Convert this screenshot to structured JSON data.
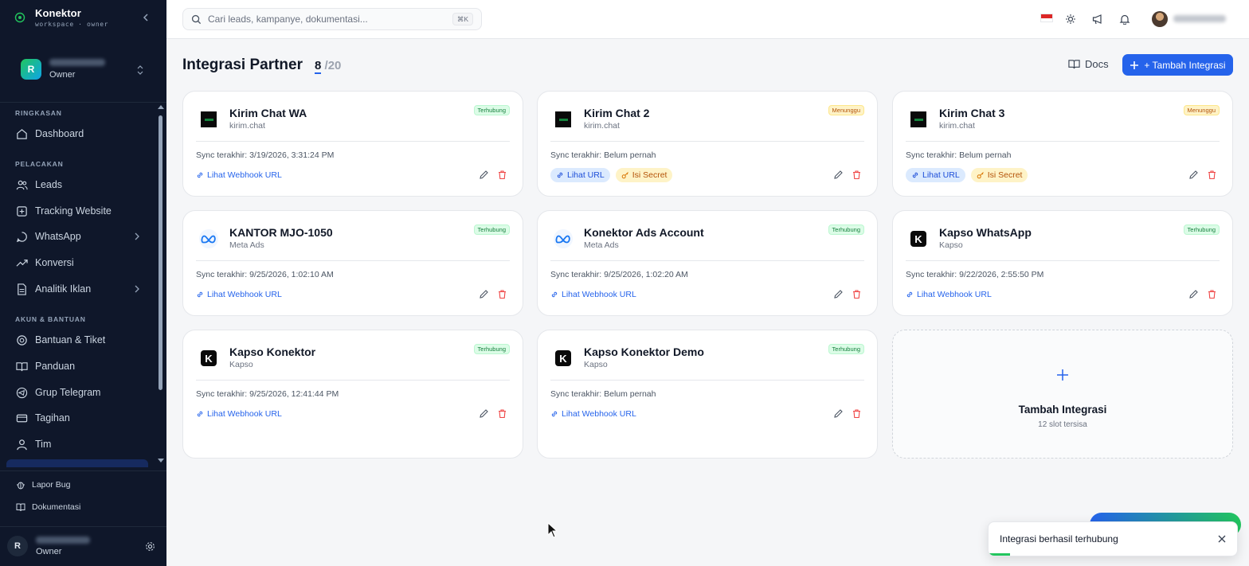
{
  "brand": {
    "name": "Konektor",
    "subtitle": "workspace · owner"
  },
  "workspace": {
    "initial": "R",
    "role": "Owner"
  },
  "nav": {
    "sections": [
      {
        "label": "RINGKASAN",
        "items": [
          {
            "label": "Dashboard",
            "icon": "home-icon"
          }
        ]
      },
      {
        "label": "PELACAKAN",
        "items": [
          {
            "label": "Leads",
            "icon": "users-icon"
          },
          {
            "label": "Tracking Website",
            "icon": "tracking-icon"
          },
          {
            "label": "WhatsApp",
            "icon": "whatsapp-icon",
            "expandable": true
          },
          {
            "label": "Konversi",
            "icon": "trend-icon"
          },
          {
            "label": "Analitik Iklan",
            "icon": "document-icon",
            "expandable": true
          }
        ]
      },
      {
        "label": "AKUN & BANTUAN",
        "items": [
          {
            "label": "Bantuan & Tiket",
            "icon": "lifebuoy-icon"
          },
          {
            "label": "Panduan",
            "icon": "book-icon"
          },
          {
            "label": "Grup Telegram",
            "icon": "telegram-icon"
          },
          {
            "label": "Tagihan",
            "icon": "billing-icon"
          },
          {
            "label": "Tim",
            "icon": "team-icon"
          }
        ]
      }
    ],
    "footer": [
      {
        "label": "Lapor Bug",
        "icon": "bug-icon"
      },
      {
        "label": "Dokumentasi",
        "icon": "book-icon"
      }
    ]
  },
  "user": {
    "initial": "R",
    "role": "Owner"
  },
  "search": {
    "placeholder": "Cari leads, kampanye, dokumentasi...",
    "shortcut": "⌘K"
  },
  "page": {
    "title": "Integrasi Partner",
    "count_current": "8",
    "count_sep": "/",
    "count_total": "20",
    "docs_label": "Docs",
    "add_label": "+ Tambah Integrasi"
  },
  "integrations": [
    {
      "name": "Kirim Chat WA",
      "provider": "kirim.chat",
      "logo": "kirimchat-logo",
      "status": "Terhubung",
      "sync": "Sync terakhir: 3/19/2026, 3:31:24 PM",
      "link": "Lihat Webhook URL"
    },
    {
      "name": "Kirim Chat 2",
      "provider": "kirim.chat",
      "logo": "kirimchat-logo",
      "status": "Menunggu",
      "sync": "Sync terakhir: Belum pernah",
      "pill_url": "Lihat URL",
      "pill_secret": "Isi Secret"
    },
    {
      "name": "Kirim Chat 3",
      "provider": "kirim.chat",
      "logo": "kirimchat-logo",
      "status": "Menunggu",
      "sync": "Sync terakhir: Belum pernah",
      "pill_url": "Lihat URL",
      "pill_secret": "Isi Secret"
    },
    {
      "name": "KANTOR MJO-1050",
      "provider": "Meta Ads",
      "logo": "meta-logo",
      "status": "Terhubung",
      "sync": "Sync terakhir: 9/25/2026, 1:02:10 AM",
      "link": "Lihat Webhook URL"
    },
    {
      "name": "Konektor Ads Account",
      "provider": "Meta Ads",
      "logo": "meta-logo",
      "status": "Terhubung",
      "sync": "Sync terakhir: 9/25/2026, 1:02:20 AM",
      "link": "Lihat Webhook URL"
    },
    {
      "name": "Kapso WhatsApp",
      "provider": "Kapso",
      "logo": "kapso-logo",
      "status": "Terhubung",
      "sync": "Sync terakhir: 9/22/2026, 2:55:50 PM",
      "link": "Lihat Webhook URL"
    },
    {
      "name": "Kapso Konektor",
      "provider": "Kapso",
      "logo": "kapso-logo",
      "status": "Terhubung",
      "sync": "Sync terakhir: 9/25/2026, 12:41:44 PM",
      "link": "Lihat Webhook URL"
    },
    {
      "name": "Kapso Konektor Demo",
      "provider": "Kapso",
      "logo": "kapso-logo",
      "status": "Terhubung",
      "sync": "Sync terakhir: Belum pernah",
      "link": "Lihat Webhook URL"
    }
  ],
  "add_card": {
    "title": "Tambah Integrasi",
    "subtitle": "12 slot tersisa"
  },
  "toast": {
    "message": "Integrasi berhasil terhubung"
  },
  "colors": {
    "primary": "#2563eb",
    "sidebar": "#0f172a",
    "connected": "#15803d",
    "waiting": "#b45309",
    "danger": "#ef4444"
  }
}
